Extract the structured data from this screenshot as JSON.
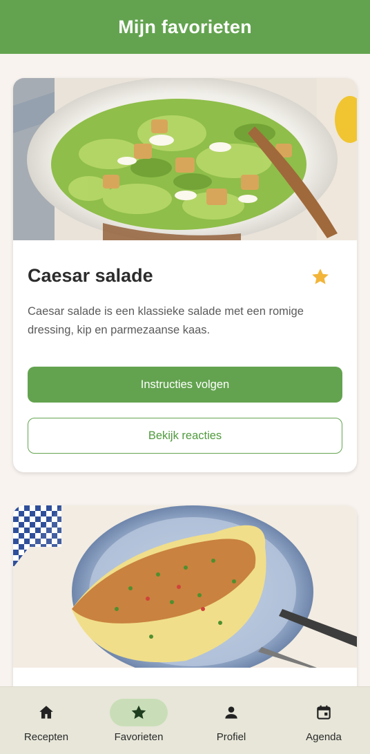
{
  "header": {
    "title": "Mijn favorieten"
  },
  "recipes": [
    {
      "title": "Caesar salade",
      "description": "Caesar salade is een klassieke salade met een romige dressing, kip en parmezaanse kaas.",
      "favorite": true,
      "primary_action": "Instructies volgen",
      "secondary_action": "Bekijk reacties"
    }
  ],
  "nav": {
    "items": [
      {
        "label": "Recepten",
        "icon": "home-icon"
      },
      {
        "label": "Favorieten",
        "icon": "star-icon",
        "active": true
      },
      {
        "label": "Profiel",
        "icon": "person-icon"
      },
      {
        "label": "Agenda",
        "icon": "calendar-icon"
      }
    ]
  },
  "colors": {
    "primary": "#63a34f",
    "background": "#f8f3ef",
    "star": "#f2b53a",
    "nav_background": "#e7e6d9",
    "nav_active_pill": "#c9deb8"
  }
}
